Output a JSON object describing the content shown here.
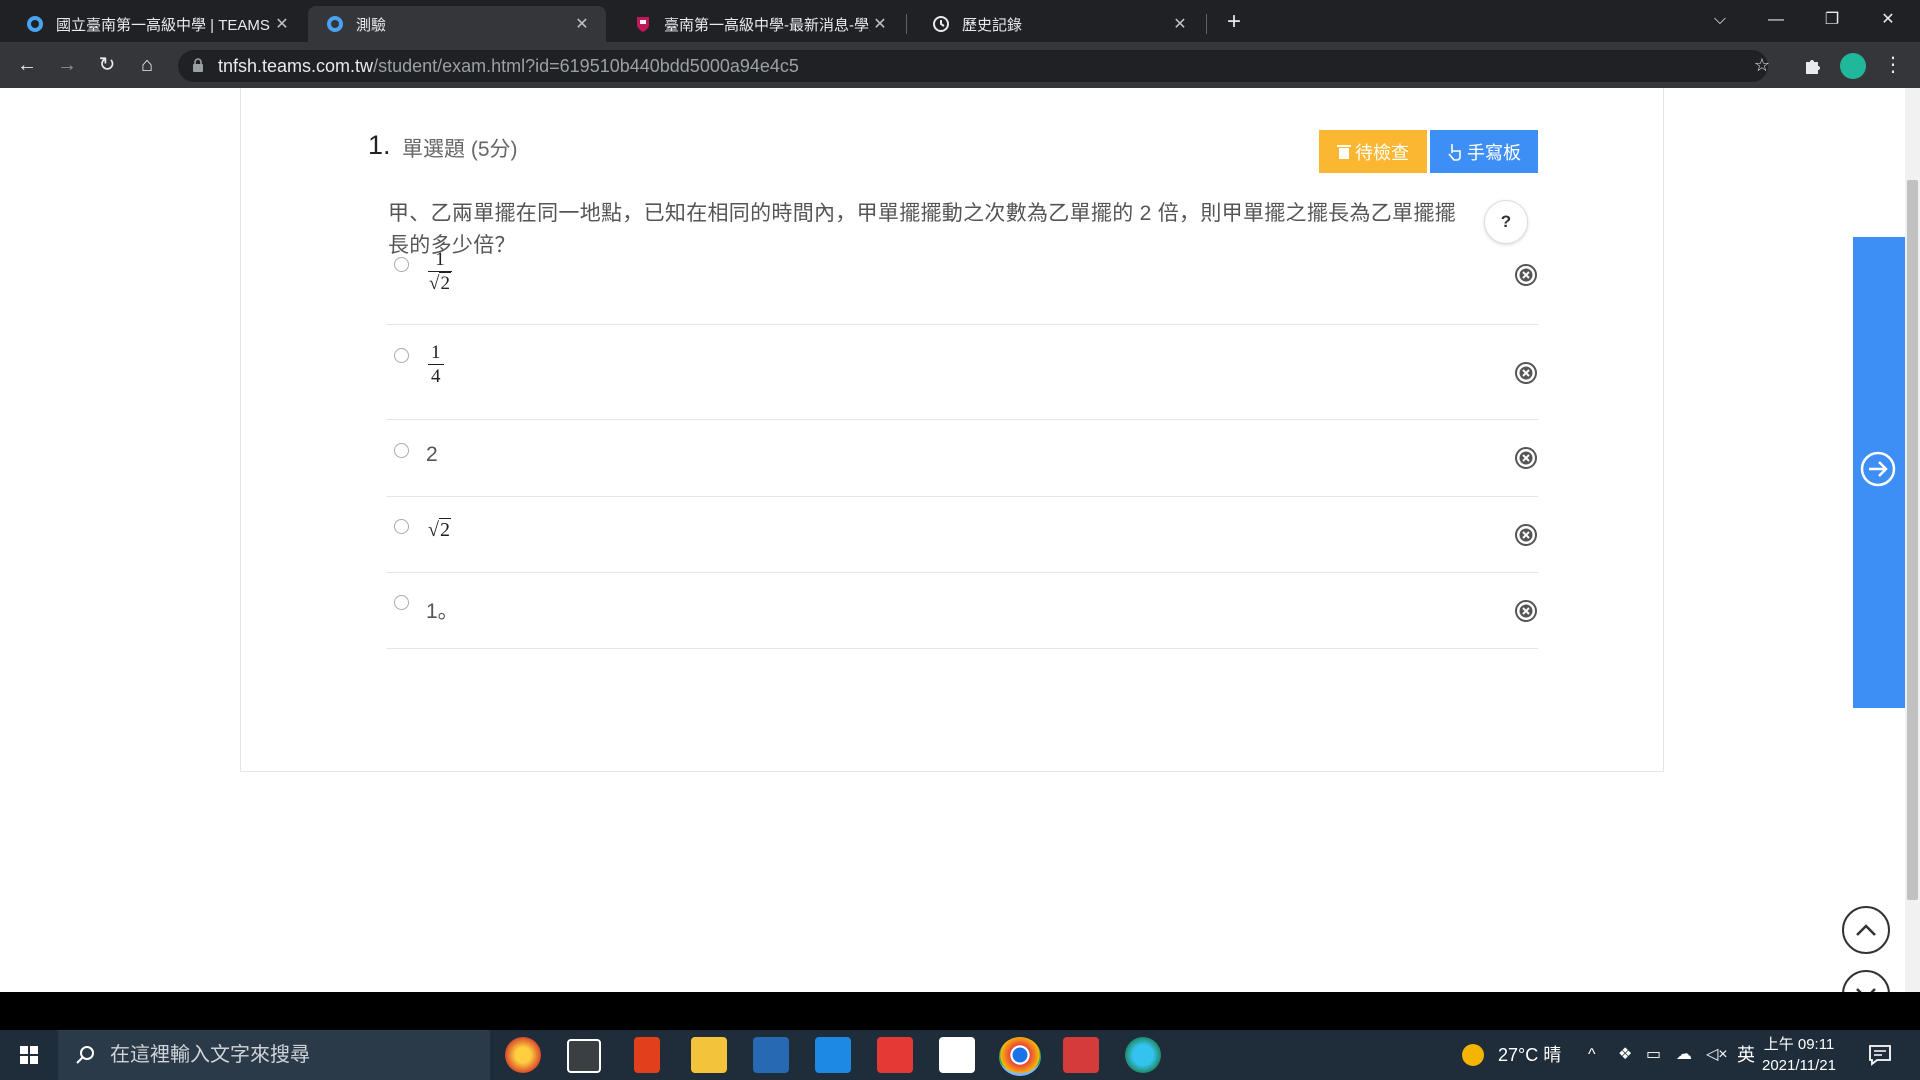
{
  "browser": {
    "tabs": [
      {
        "title": "國立臺南第一高級中學 | TEAMS",
        "active": false
      },
      {
        "title": "測驗",
        "active": true
      },
      {
        "title": "臺南第一高級中學-最新消息-學生",
        "active": false
      },
      {
        "title": "歷史記錄",
        "active": false
      }
    ],
    "url_host": "tnfsh.teams.com.tw",
    "url_path": "/student/exam.html?id=619510b440bdd5000a94e4c5"
  },
  "question": {
    "number": "1.",
    "type_label": "單選題 (5分)",
    "review_button": "待檢查",
    "pad_button": "手寫板",
    "help_label": "?",
    "stem": "甲、乙兩單擺在同一地點，已知在相同的時間內，甲單擺擺動之次數為乙單擺的 2 倍，則甲單擺之擺長為乙單擺擺長的多少倍？",
    "options": [
      {
        "kind": "frac-sqrt",
        "num": "1",
        "den": "2"
      },
      {
        "kind": "frac",
        "num": "1",
        "den": "4"
      },
      {
        "kind": "text",
        "text": "2"
      },
      {
        "kind": "sqrt",
        "text": "2"
      },
      {
        "kind": "text",
        "text": "1。"
      }
    ]
  },
  "taskbar": {
    "search_placeholder": "在這裡輸入文字來搜尋",
    "weather": "27°C 晴",
    "ime": "英",
    "time": "上午 09:11",
    "date": "2021/11/21"
  },
  "colors": {
    "review": "#fbb731",
    "pad": "#3e8ff5",
    "side_panel": "#3e8ff5"
  }
}
